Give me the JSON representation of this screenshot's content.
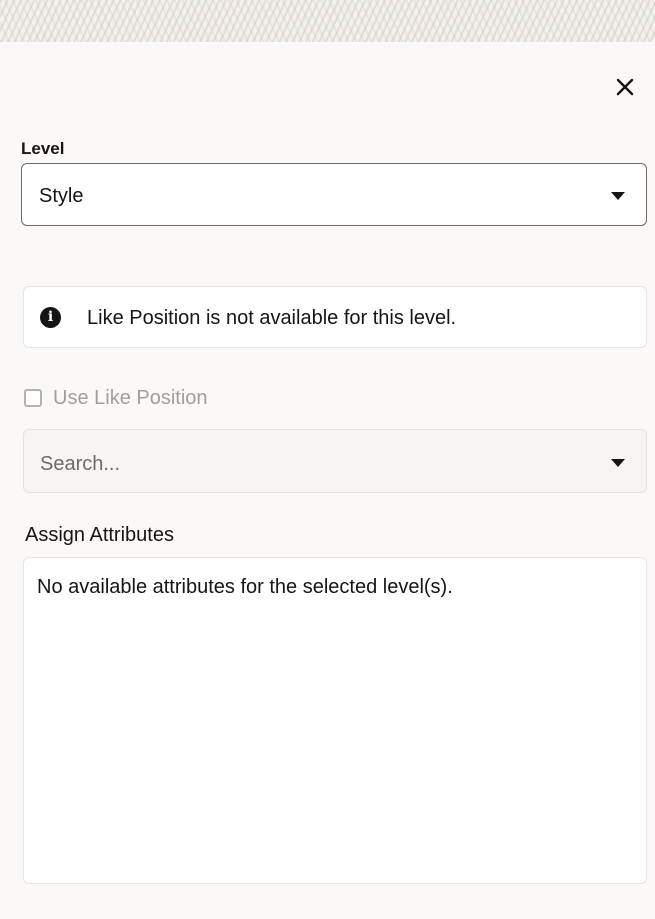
{
  "header": {
    "close_icon": "close-icon"
  },
  "level": {
    "label": "Level",
    "selected_value": "Style",
    "caret_icon": "caret-down-icon"
  },
  "info_message": {
    "icon": "info-icon",
    "text": "Like Position is not available for this level."
  },
  "like_position": {
    "label": "Use Like Position",
    "checked": false,
    "disabled": true
  },
  "search": {
    "placeholder": "Search...",
    "caret_icon": "caret-down-icon"
  },
  "assign_attributes": {
    "label": "Assign Attributes",
    "empty_message": "No available attributes for the selected level(s)."
  }
}
